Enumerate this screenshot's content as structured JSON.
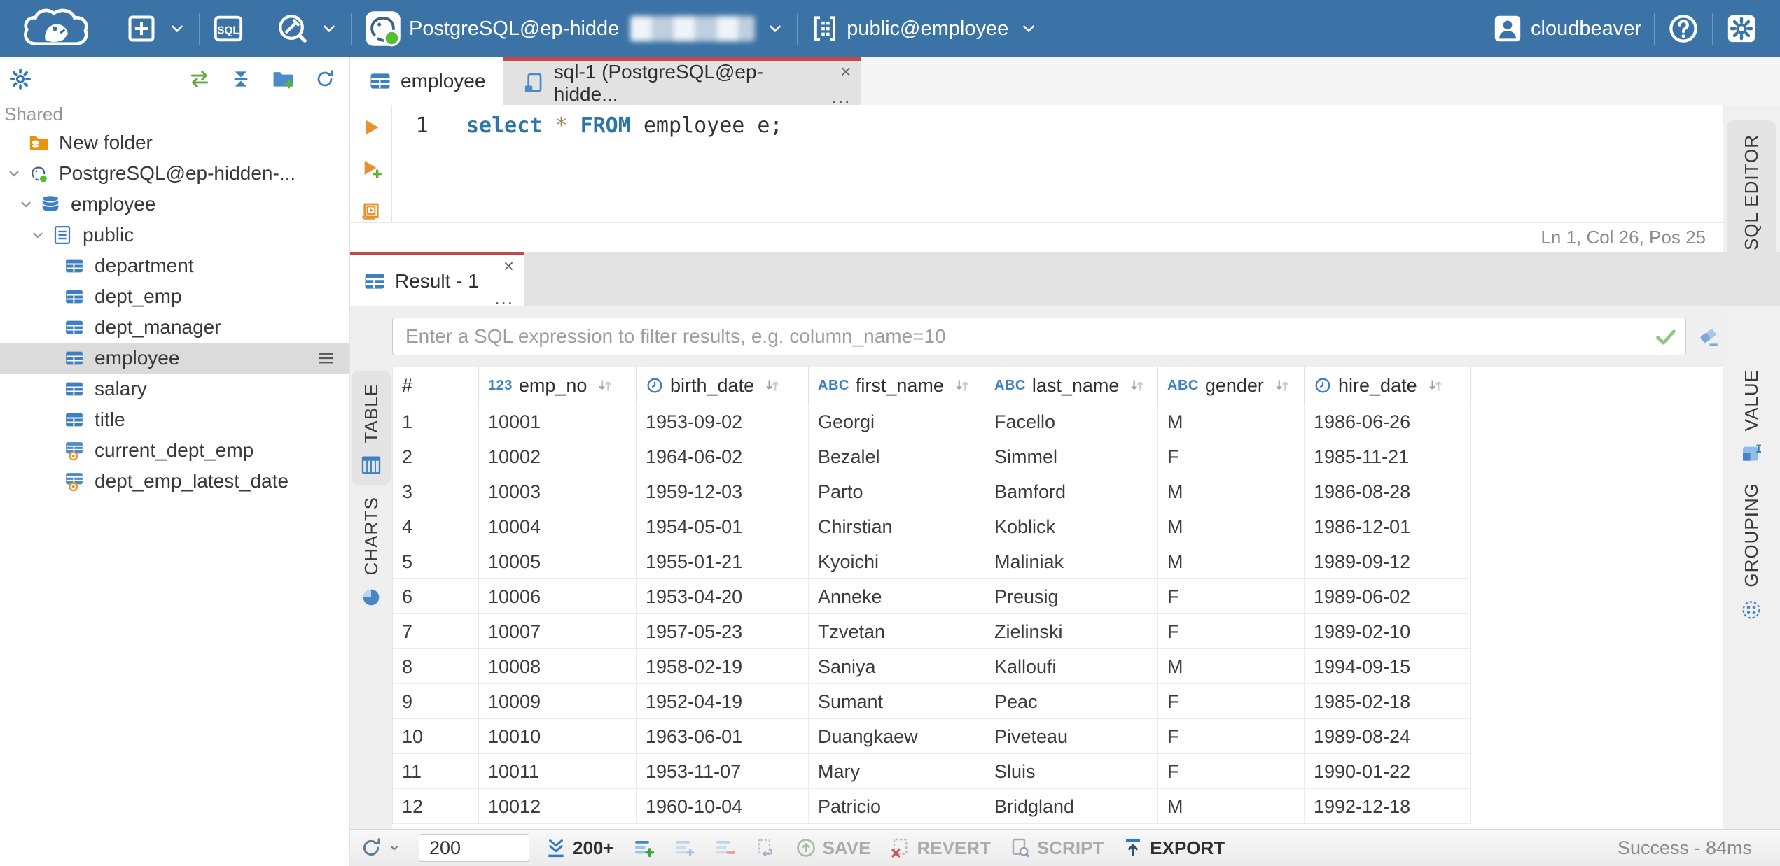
{
  "topbar": {
    "sql_badge": "SQL",
    "connection_label": "PostgreSQL@ep-hidde",
    "connection_redacted": true,
    "schema_label": "public@employee",
    "username": "cloudbeaver",
    "help_glyph": "?",
    "icons": [
      "cloudbeaver-logo",
      "new-connection-icon",
      "sql-editor-icon",
      "driver-icon",
      "postgres-icon",
      "schema-selector-icon",
      "user-icon",
      "help-icon",
      "settings-icon"
    ]
  },
  "sidebar": {
    "section_label": "Shared",
    "toolbar_icons": [
      "settings-gear-icon",
      "sync-connections-icon",
      "collapse-all-icon",
      "add-folder-icon",
      "refresh-tree-icon"
    ],
    "tree": [
      {
        "label": "New folder",
        "icon": "folderdb",
        "level": 0
      },
      {
        "label": "PostgreSQL@ep-hidden-...",
        "icon": "pg",
        "level": 0,
        "expanded": true
      },
      {
        "label": "employee",
        "icon": "db",
        "level": 1,
        "expanded": true
      },
      {
        "label": "public",
        "icon": "schema",
        "level": 2,
        "expanded": true
      },
      {
        "label": "department",
        "icon": "table",
        "level": 3
      },
      {
        "label": "dept_emp",
        "icon": "table",
        "level": 3
      },
      {
        "label": "dept_manager",
        "icon": "table",
        "level": 3
      },
      {
        "label": "employee",
        "icon": "table",
        "level": 3,
        "selected": true
      },
      {
        "label": "salary",
        "icon": "table",
        "level": 3
      },
      {
        "label": "title",
        "icon": "table",
        "level": 3
      },
      {
        "label": "current_dept_emp",
        "icon": "view",
        "level": 3
      },
      {
        "label": "dept_emp_latest_date",
        "icon": "view",
        "level": 3
      }
    ]
  },
  "tabs": [
    {
      "label": "employee",
      "icon": "table-icon",
      "active": false
    },
    {
      "label": "sql-1 (PostgreSQL@ep-hidde...",
      "icon": "sql-script-icon",
      "active": true,
      "close": "×",
      "more": "..."
    }
  ],
  "editor": {
    "line_number": "1",
    "tokens": {
      "keyword1": "select",
      "star": "*",
      "keyword2": "FROM",
      "text": "employee e;"
    },
    "status": "Ln 1, Col 26, Pos 25",
    "side_tab": "SQL EDITOR",
    "exec_icons": [
      "execute-icon",
      "execute-new-tab-icon",
      "execute-script-icon"
    ]
  },
  "result": {
    "tab": {
      "label": "Result - 1",
      "close": "×",
      "more": "..."
    },
    "filter_placeholder": "Enter a SQL expression to filter results, e.g. column_name=10",
    "left_tabs": [
      {
        "label": "TABLE",
        "icon": "table-view-icon",
        "active": true
      },
      {
        "label": "CHARTS",
        "icon": "pie-chart-icon",
        "active": false
      }
    ],
    "right_tabs": [
      {
        "label": "VALUE",
        "icon": "value-panel-icon"
      },
      {
        "label": "GROUPING",
        "icon": "grouping-icon"
      }
    ]
  },
  "grid": {
    "columns": [
      {
        "label": "#",
        "type": "index"
      },
      {
        "label": "emp_no",
        "type": "number"
      },
      {
        "label": "birth_date",
        "type": "datetime"
      },
      {
        "label": "first_name",
        "type": "string"
      },
      {
        "label": "last_name",
        "type": "string"
      },
      {
        "label": "gender",
        "type": "string"
      },
      {
        "label": "hire_date",
        "type": "datetime"
      }
    ],
    "rows": [
      [
        "1",
        "10001",
        "1953-09-02",
        "Georgi",
        "Facello",
        "M",
        "1986-06-26"
      ],
      [
        "2",
        "10002",
        "1964-06-02",
        "Bezalel",
        "Simmel",
        "F",
        "1985-11-21"
      ],
      [
        "3",
        "10003",
        "1959-12-03",
        "Parto",
        "Bamford",
        "M",
        "1986-08-28"
      ],
      [
        "4",
        "10004",
        "1954-05-01",
        "Chirstian",
        "Koblick",
        "M",
        "1986-12-01"
      ],
      [
        "5",
        "10005",
        "1955-01-21",
        "Kyoichi",
        "Maliniak",
        "M",
        "1989-09-12"
      ],
      [
        "6",
        "10006",
        "1953-04-20",
        "Anneke",
        "Preusig",
        "F",
        "1989-06-02"
      ],
      [
        "7",
        "10007",
        "1957-05-23",
        "Tzvetan",
        "Zielinski",
        "F",
        "1989-02-10"
      ],
      [
        "8",
        "10008",
        "1958-02-19",
        "Saniya",
        "Kalloufi",
        "M",
        "1994-09-15"
      ],
      [
        "9",
        "10009",
        "1952-04-19",
        "Sumant",
        "Peac",
        "F",
        "1985-02-18"
      ],
      [
        "10",
        "10010",
        "1963-06-01",
        "Duangkaew",
        "Piveteau",
        "F",
        "1989-08-24"
      ],
      [
        "11",
        "10011",
        "1953-11-07",
        "Mary",
        "Sluis",
        "F",
        "1990-01-22"
      ],
      [
        "12",
        "10012",
        "1960-10-04",
        "Patricio",
        "Bridgland",
        "M",
        "1992-12-18"
      ]
    ]
  },
  "toolbar": {
    "fetch_size": "200",
    "fetch_more_label": "200+",
    "save_label": "SAVE",
    "revert_label": "REVERT",
    "script_label": "SCRIPT",
    "export_label": "EXPORT",
    "status": "Success - 84ms",
    "icons": [
      "refresh-icon",
      "fetch-more-icon",
      "add-row-icon",
      "duplicate-row-icon",
      "delete-row-icon",
      "apply-icon",
      "save-icon",
      "revert-icon",
      "script-icon",
      "export-icon"
    ]
  },
  "colors": {
    "topbar_blue": "#3C73A6",
    "accent_red": "#C8474C",
    "icon_blue": "#3E7FC1",
    "green": "#67A63C",
    "orange": "#E8912D",
    "selected_gray": "#DBDBDB"
  }
}
